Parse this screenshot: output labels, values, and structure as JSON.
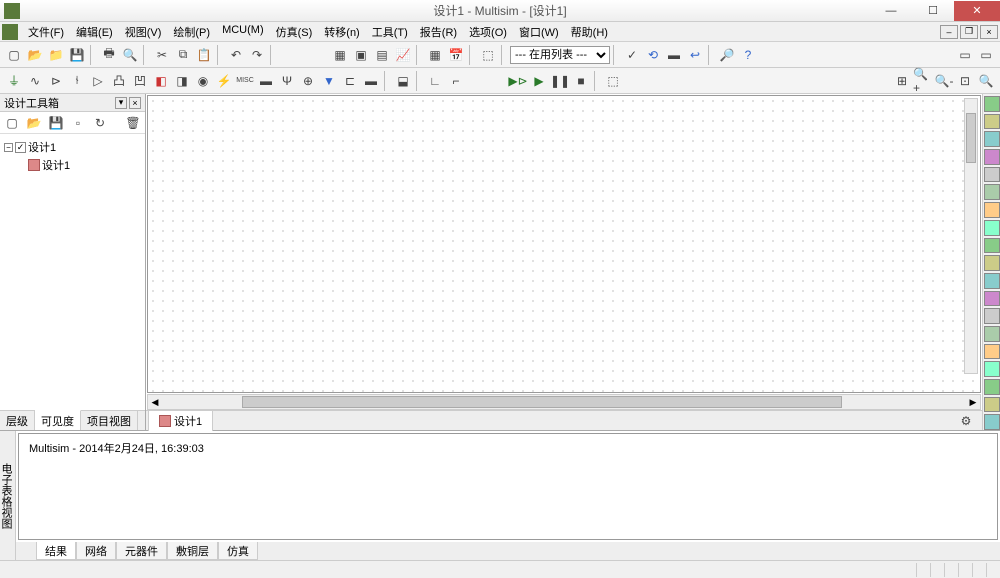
{
  "title": "设计1 - Multisim - [设计1]",
  "menu": [
    "文件(F)",
    "编辑(E)",
    "视图(V)",
    "绘制(P)",
    "MCU(M)",
    "仿真(S)",
    "转移(n)",
    "工具(T)",
    "报告(R)",
    "选项(O)",
    "窗口(W)",
    "帮助(H)"
  ],
  "sidebar": {
    "title": "设计工具箱",
    "tree_root": "设计1",
    "tree_child": "设计1",
    "tabs": [
      "层级",
      "可见度",
      "项目视图"
    ],
    "active_tab": 1
  },
  "document_tab": "设计1",
  "dropdown_value": "--- 在用列表 ---",
  "bottom": {
    "label": "电子表格视图",
    "message": "Multisim  -  2014年2月24日, 16:39:03",
    "tabs": [
      "结果",
      "网络",
      "元器件",
      "敷铜层",
      "仿真"
    ],
    "active_tab": 0
  },
  "right_tools": [
    "XMM",
    "XFG",
    "XSC",
    "XBP",
    "XFC",
    "XWM",
    "XDA",
    "XDG",
    "XLA",
    "XLC",
    "XIV",
    "XVA",
    "XPW",
    "XSA",
    "ASC",
    "TEK",
    "LV1",
    "LV2",
    "MV"
  ]
}
